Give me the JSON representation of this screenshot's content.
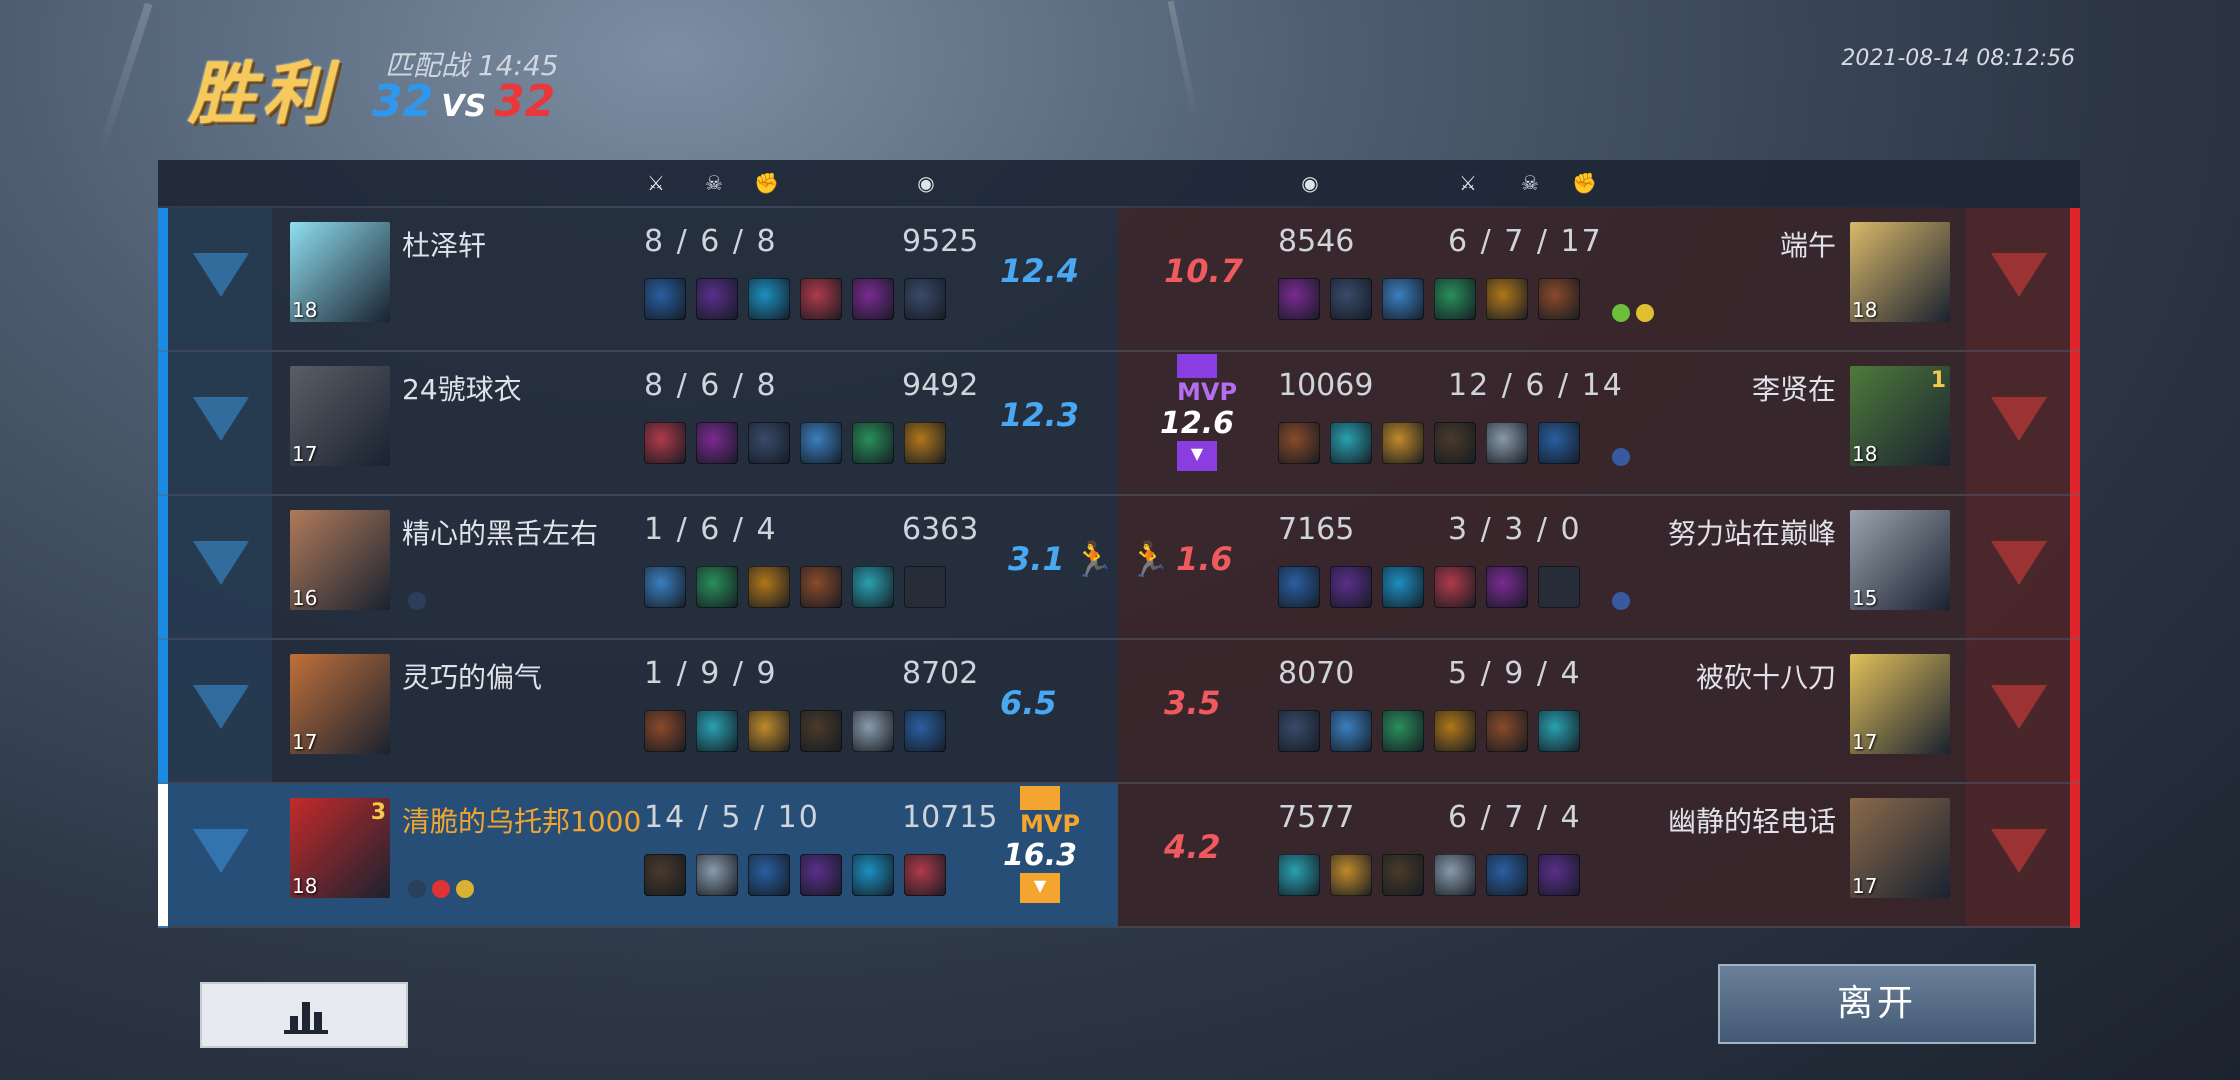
{
  "header": {
    "result": "胜利",
    "mode": "匹配战",
    "duration": "14:45",
    "blue_score": "32",
    "vs": "VS",
    "red_score": "32",
    "datetime": "2021-08-14  08:12:56"
  },
  "column_icons": [
    "crossed-swords-icon",
    "skull-icon",
    "fist-icon",
    "coin-icon"
  ],
  "blue_team": [
    {
      "name": "杜泽轩",
      "level": "18",
      "kda": "8 / 6 / 8",
      "gold": "9525",
      "score": "12.4",
      "avatar_color": "#8fdff0"
    },
    {
      "name": "24號球衣",
      "level": "17",
      "kda": "8 / 6 / 8",
      "gold": "9492",
      "score": "12.3",
      "avatar_color": "#5a5f66"
    },
    {
      "name": "精心的黑舌左右",
      "level": "16",
      "kda": "1 / 6 / 4",
      "gold": "6363",
      "score": "3.1",
      "avatar_color": "#b07a5a"
    },
    {
      "name": "灵巧的偏气",
      "level": "17",
      "kda": "1 / 9 / 9",
      "gold": "8702",
      "score": "6.5",
      "avatar_color": "#c0703a"
    },
    {
      "name": "清脆的乌托邦1000",
      "level": "18",
      "kda": "14 / 5 / 10",
      "gold": "10715",
      "score": "16.3",
      "avatar_color": "#c42a2a",
      "mvp": "MVP",
      "self": true,
      "badge": "3"
    }
  ],
  "red_team": [
    {
      "name": "端午",
      "level": "18",
      "kda": "6 / 7 / 17",
      "gold": "8546",
      "score": "10.7",
      "avatar_color": "#d9b86a"
    },
    {
      "name": "李贤在",
      "level": "18",
      "kda": "12 / 6 / 14",
      "gold": "10069",
      "score": "12.6",
      "avatar_color": "#4f7a3a",
      "mvp": "MVP",
      "badge": "1"
    },
    {
      "name": "努力站在巅峰",
      "level": "15",
      "kda": "3 / 3 / 0",
      "gold": "7165",
      "score": "1.6",
      "avatar_color": "#9aa3ad"
    },
    {
      "name": "被砍十八刀",
      "level": "17",
      "kda": "5 / 9 / 4",
      "gold": "8070",
      "score": "3.5",
      "avatar_color": "#e2c05a"
    },
    {
      "name": "幽静的轻电话",
      "level": "17",
      "kda": "6 / 7 / 4",
      "gold": "7577",
      "score": "4.2",
      "avatar_color": "#8a6a4a"
    }
  ],
  "buttons": {
    "leave": "离开"
  },
  "colors": {
    "blue": "#2f98ee",
    "red": "#e8383c",
    "mvp_gold": "#f3a530",
    "mvp_purple": "#8a3de0"
  }
}
